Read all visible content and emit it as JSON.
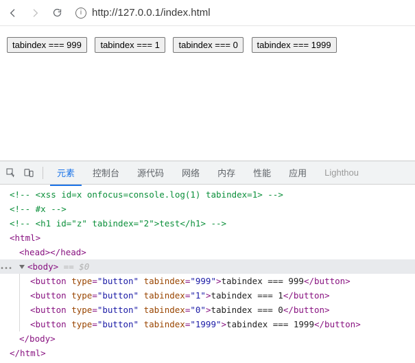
{
  "toolbar": {
    "url": "http://127.0.0.1/index.html"
  },
  "page": {
    "buttons": [
      {
        "label": "tabindex === 999"
      },
      {
        "label": "tabindex === 1"
      },
      {
        "label": "tabindex === 0"
      },
      {
        "label": "tabindex === 1999"
      }
    ]
  },
  "devtools": {
    "tabs": {
      "elements": "元素",
      "console": "控制台",
      "sources": "源代码",
      "network": "网络",
      "memory": "内存",
      "performance": "性能",
      "application": "应用",
      "lighthouse": "Lighthou"
    }
  },
  "dom": {
    "comment1": "<!-- <xss id=x onfocus=console.log(1) tabindex=1> -->",
    "comment2": "<!-- #x -->",
    "comment3": "<!-- <h1 id=\"z\" tabindex=\"2\">test</h1> -->",
    "html_open": "<html>",
    "head": {
      "open": "<head>",
      "close": "</head>"
    },
    "body": {
      "open": "<body>",
      "hint": " == $0",
      "close": "</body>"
    },
    "html_close": "</html>",
    "buttons": [
      {
        "type_attr": "type",
        "type_val": "\"button\"",
        "ti_attr": "tabindex",
        "ti_val": "\"999\"",
        "text": "tabindex === 999"
      },
      {
        "type_attr": "type",
        "type_val": "\"button\"",
        "ti_attr": "tabindex",
        "ti_val": "\"1\"",
        "text": "tabindex === 1"
      },
      {
        "type_attr": "type",
        "type_val": "\"button\"",
        "ti_attr": "tabindex",
        "ti_val": "\"0\"",
        "text": "tabindex === 0"
      },
      {
        "type_attr": "type",
        "type_val": "\"button\"",
        "ti_attr": "tabindex",
        "ti_val": "\"1999\"",
        "text": "tabindex === 1999"
      }
    ]
  }
}
